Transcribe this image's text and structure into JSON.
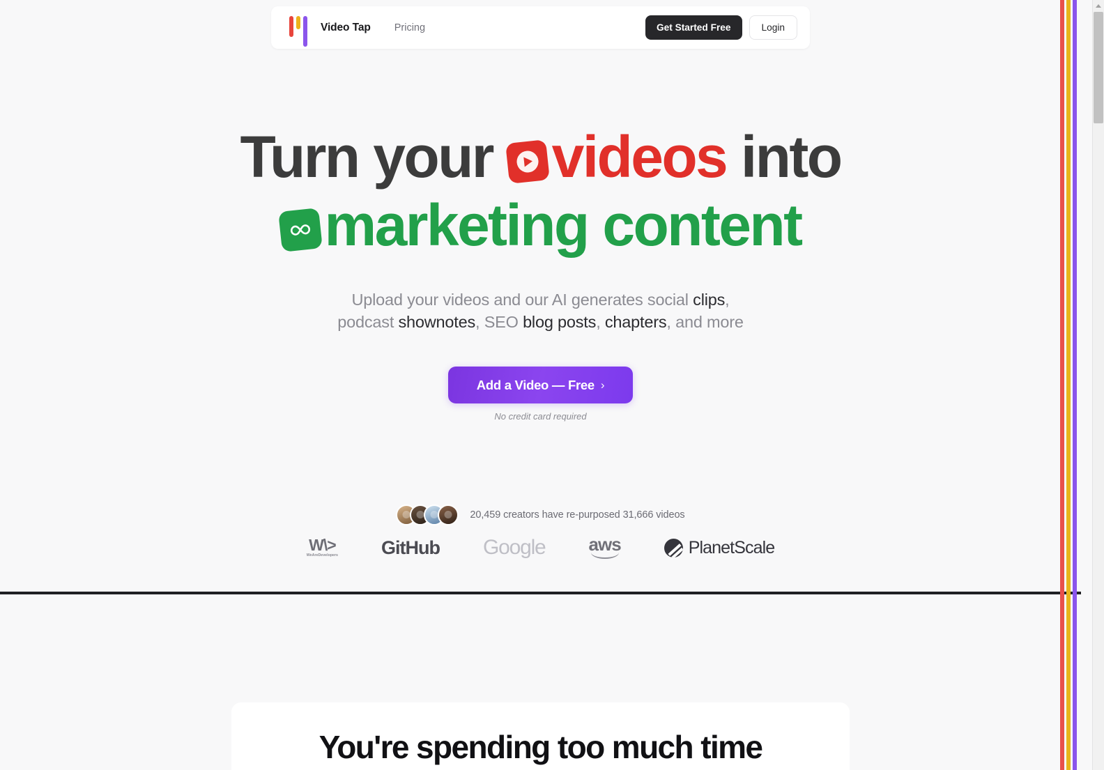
{
  "header": {
    "brand_name": "Video Tap",
    "logo_bars": [
      "red",
      "yellow",
      "purple"
    ],
    "nav": {
      "pricing": "Pricing"
    },
    "cta_primary": "Get Started Free",
    "cta_secondary": "Login"
  },
  "hero": {
    "headline_line1_part1": "Turn your",
    "headline_line1_highlight": "videos",
    "headline_line1_part2": "into",
    "headline_line2_highlight": "marketing content",
    "subhead_line1_pre": "Upload your videos and our AI generates social ",
    "subhead_line1_strong": "clips",
    "subhead_line1_post": ",",
    "subhead_line2_a": "podcast ",
    "subhead_line2_strong1": "shownotes",
    "subhead_line2_b": ", SEO ",
    "subhead_line2_strong2": "blog posts",
    "subhead_line2_c": ", ",
    "subhead_line2_strong3": "chapters",
    "subhead_line2_d": ", and more",
    "cta_label": "Add a Video — Free",
    "cta_chevron": "›",
    "cta_note": "No credit card required",
    "colors": {
      "videos_red": "#e1302a",
      "marketing_green": "#22a04a",
      "cta_purple": "#7c3aed",
      "headline_dark": "#3c3c3c"
    }
  },
  "social_proof": {
    "text": "20,459 creators have re-purposed 31,666 videos",
    "creators_count": "20,459",
    "videos_count": "31,666",
    "avatar_count": 4
  },
  "brand_logos": [
    {
      "name": "WeAreDevelopers",
      "mark": "W\\>",
      "sub": "WeAreDevelopers"
    },
    {
      "name": "GitHub",
      "mark": "GitHub"
    },
    {
      "name": "Google",
      "mark": "Google"
    },
    {
      "name": "aws",
      "mark": "aws"
    },
    {
      "name": "PlanetScale",
      "mark": "PlanetScale"
    }
  ],
  "section_two": {
    "title": "You're spending too much time"
  },
  "decor": {
    "stripe_colors": [
      "#e8514b",
      "#e8b51c",
      "#8b55ec"
    ]
  }
}
